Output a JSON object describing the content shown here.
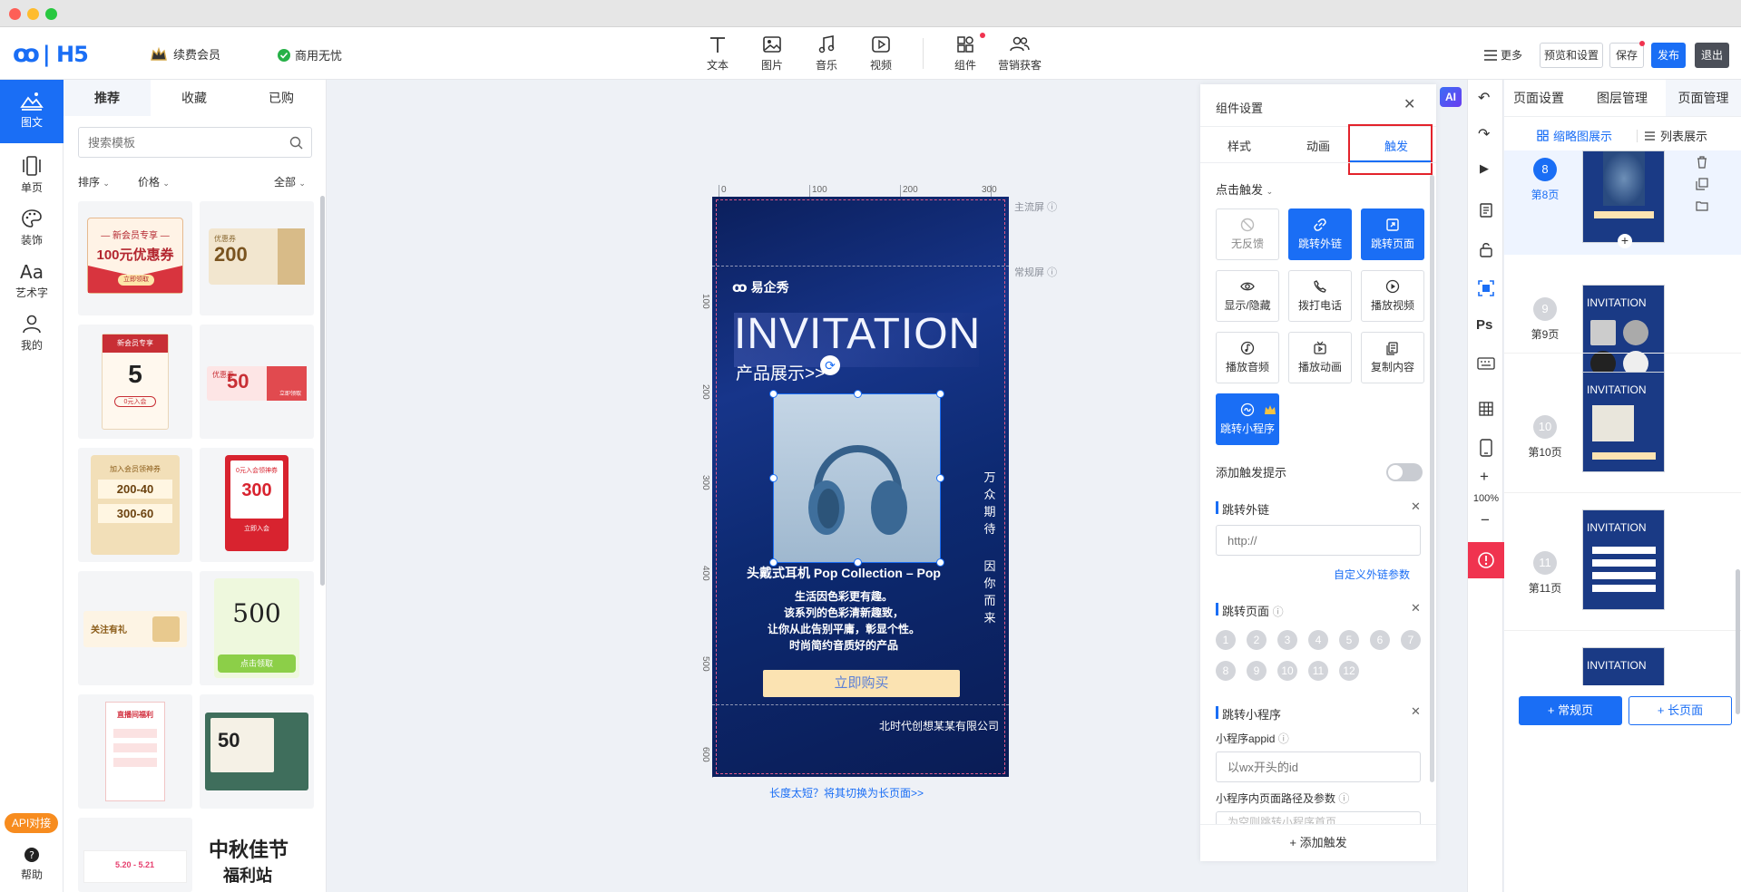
{
  "app": {
    "logo": "易企秀H5",
    "vip_label": "续费会员",
    "commercial_label": "商用无忧"
  },
  "toolbar": {
    "items": [
      {
        "label": "文本",
        "icon": "text-icon"
      },
      {
        "label": "图片",
        "icon": "image-icon"
      },
      {
        "label": "音乐",
        "icon": "music-icon"
      },
      {
        "label": "视频",
        "icon": "video-icon"
      },
      {
        "label": "组件",
        "icon": "component-icon"
      },
      {
        "label": "营销获客",
        "icon": "users-icon"
      }
    ],
    "more": "更多",
    "preview": "预览和设置",
    "save": "保存",
    "publish": "发布",
    "exit": "退出"
  },
  "sidebar": {
    "items": [
      "图文",
      "单页",
      "装饰",
      "艺术字",
      "我的"
    ],
    "api": "API对接",
    "help": "帮助"
  },
  "templates": {
    "tabs": [
      "推荐",
      "收藏",
      "已购"
    ],
    "search_placeholder": "搜索模板",
    "filter_sort": "排序",
    "filter_price": "价格",
    "filter_all": "全部",
    "cards": [
      {
        "main": "100元优惠券",
        "sub": "— 新会员专享 —",
        "btn": "立即领取"
      },
      {
        "main": "200",
        "sub": "优惠券",
        "btn": ""
      },
      {
        "main": "5",
        "sub": "新会员专享",
        "btn": "0元入会"
      },
      {
        "main": "50",
        "sub": "优惠券",
        "btn": "立即领取"
      },
      {
        "main": "200-40",
        "sub": "加入会员领神券",
        "btn": "300-60"
      },
      {
        "main": "300",
        "sub": "0元入会领神券",
        "btn": "立即入会"
      },
      {
        "main": "关注有礼",
        "sub": "",
        "btn": ""
      },
      {
        "main": "500",
        "sub": "",
        "btn": "点击领取"
      },
      {
        "main": "直播间福利",
        "sub": "",
        "btn": ""
      },
      {
        "main": "50",
        "sub": "",
        "btn": ""
      },
      {
        "main": "5.20 - 5.21",
        "sub": "",
        "btn": ""
      },
      {
        "main": "中秋佳节",
        "sub": "福利站",
        "btn": ""
      }
    ]
  },
  "canvas": {
    "brand": "易企秀",
    "title": "INVITATION",
    "subtitle": "产品展示>>",
    "product_name": "头戴式耳机 Pop Collection – Pop",
    "desc": [
      "生活因色彩更有趣。",
      "该系列的色彩清新趣致，",
      "让你从此告别平庸，彰显个性。",
      "时尚简约音质好的产品"
    ],
    "vertical_text": [
      "万众期待",
      "因你而来"
    ],
    "buy_btn": "立即购买",
    "company": "北时代创想某某有限公司",
    "main_screen": "主流屏",
    "normal_screen": "常规屏",
    "switch_hint": "长度太短？将其切换为长页面>>",
    "ruler_h": [
      "0",
      "100",
      "200",
      "300"
    ],
    "ruler_v": [
      "100",
      "200",
      "300",
      "400",
      "500",
      "600"
    ]
  },
  "settings": {
    "title": "组件设置",
    "tabs": [
      "样式",
      "动画",
      "触发"
    ],
    "click_trigger": "点击触发",
    "triggers": [
      "无反馈",
      "跳转外链",
      "跳转页面",
      "显示/隐藏",
      "拨打电话",
      "播放视频",
      "播放音频",
      "播放动画",
      "复制内容",
      "跳转小程序"
    ],
    "add_hint": "添加触发提示",
    "ext_link_title": "跳转外链",
    "ext_link_placeholder": "http://",
    "custom_params": "自定义外链参数",
    "jump_page_title": "跳转页面",
    "pages": [
      "1",
      "2",
      "3",
      "4",
      "5",
      "6",
      "7",
      "8",
      "9",
      "10",
      "11",
      "12"
    ],
    "mini_title": "跳转小程序",
    "appid_label": "小程序appid",
    "appid_placeholder": "以wx开头的id",
    "path_label": "小程序内页面路径及参数",
    "path_placeholder": "为空则跳转小程序首页",
    "add_trigger": "+ 添加触发"
  },
  "right_tools": {
    "ai": "AI",
    "zoom": "100%",
    "ps": "Ps"
  },
  "page_manager": {
    "tabs": [
      "页面设置",
      "图层管理",
      "页面管理"
    ],
    "view_thumb": "缩略图展示",
    "view_list": "列表展示",
    "pages": [
      {
        "num": "8",
        "label": "第8页"
      },
      {
        "num": "9",
        "label": "第9页"
      },
      {
        "num": "10",
        "label": "第10页"
      },
      {
        "num": "11",
        "label": "第11页"
      }
    ],
    "add_normal": "+ 常规页",
    "add_long": "+ 长页面"
  },
  "colors": {
    "accent": "#1a6ef5",
    "danger": "#f0334f",
    "bg": "#eef1f6"
  }
}
